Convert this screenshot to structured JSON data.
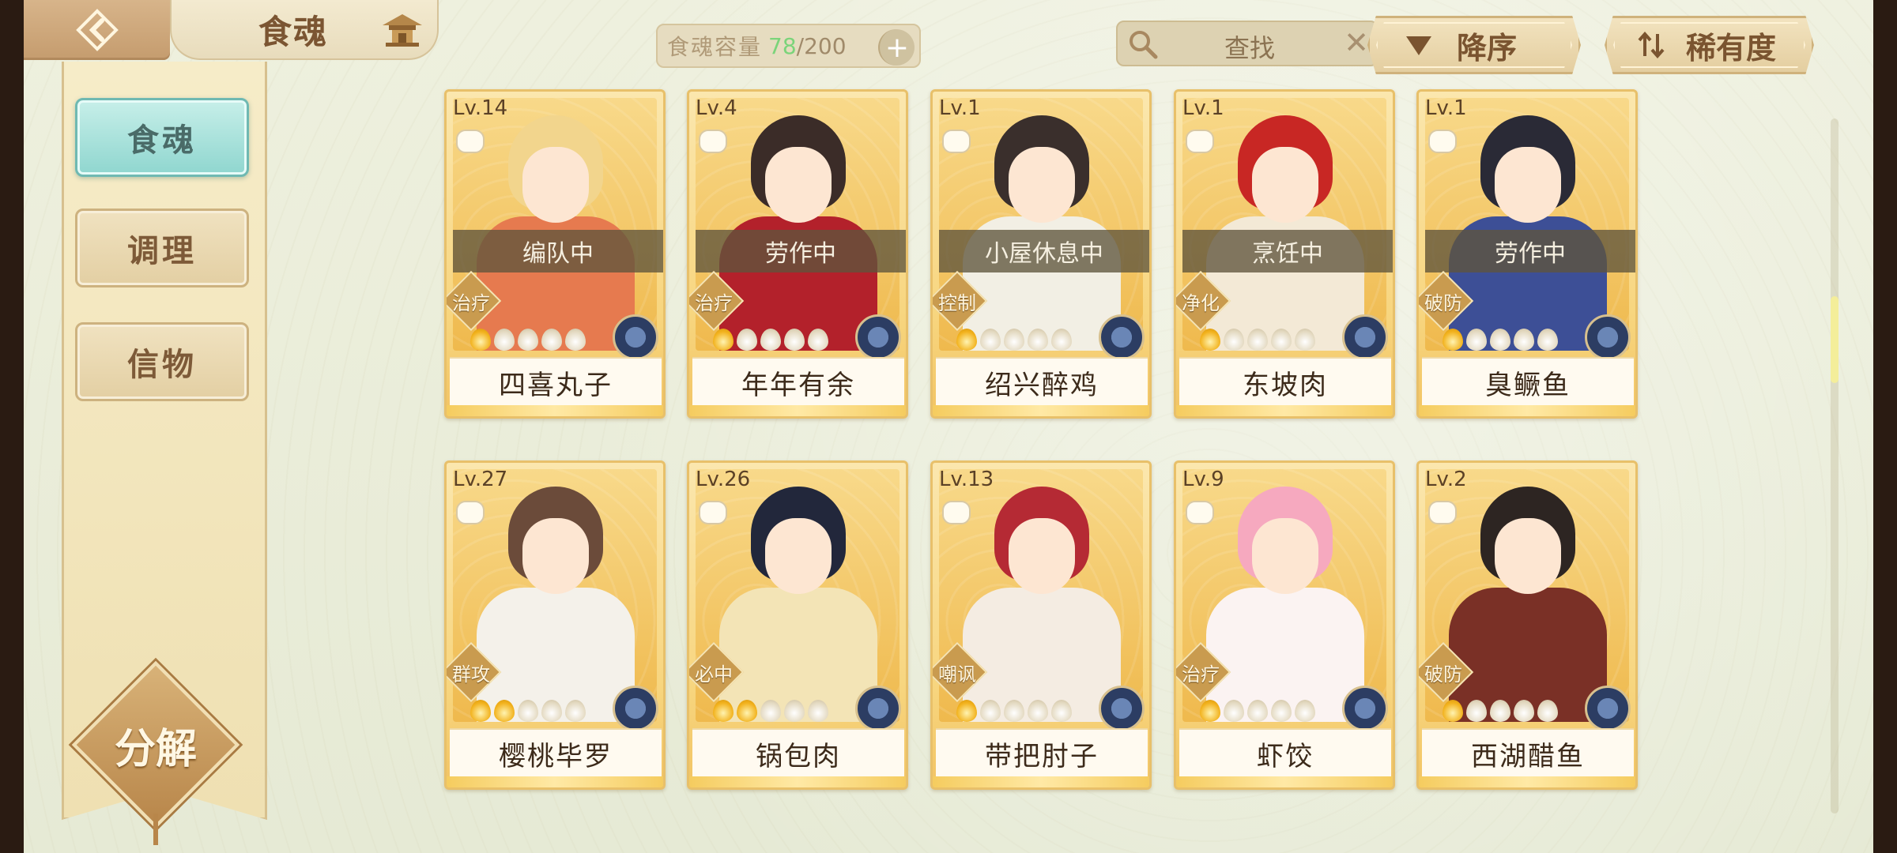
{
  "header": {
    "title": "食魂",
    "back_icon": "back-arrow-icon",
    "home_icon": "pavilion-home-icon"
  },
  "capacity": {
    "label": "食魂容量",
    "current": "78",
    "separator": "/",
    "max": "200",
    "plus": "+"
  },
  "search": {
    "placeholder": "查找",
    "clear": "✕"
  },
  "sort": {
    "order_label": "降序",
    "filter_label": "稀有度"
  },
  "sidebar": {
    "tabs": [
      {
        "label": "食魂",
        "active": true
      },
      {
        "label": "调理",
        "active": false
      },
      {
        "label": "信物",
        "active": false
      }
    ],
    "decompose_label": "分解"
  },
  "cards": [
    {
      "level": "Lv.14",
      "name": "四喜丸子",
      "status": "编队中",
      "role": "治疗",
      "stars_on": 1,
      "hair": "#f2d58d",
      "outfit": "#e67a4f"
    },
    {
      "level": "Lv.4",
      "name": "年年有余",
      "status": "劳作中",
      "role": "治疗",
      "stars_on": 1,
      "hair": "#3b2c28",
      "outfit": "#b3212b"
    },
    {
      "level": "Lv.1",
      "name": "绍兴醉鸡",
      "status": "小屋休息中",
      "role": "控制",
      "stars_on": 1,
      "hair": "#3a2f2c",
      "outfit": "#f2efe4"
    },
    {
      "level": "Lv.1",
      "name": "东坡肉",
      "status": "烹饪中",
      "role": "净化",
      "stars_on": 1,
      "hair": "#c82724",
      "outfit": "#f3e9d6"
    },
    {
      "level": "Lv.1",
      "name": "臭鳜鱼",
      "status": "劳作中",
      "role": "破防",
      "stars_on": 1,
      "hair": "#2a2a36",
      "outfit": "#3d4f96"
    },
    {
      "level": "Lv.27",
      "name": "樱桃毕罗",
      "status": "",
      "role": "群攻",
      "stars_on": 2,
      "hair": "#6b4b3a",
      "outfit": "#f4f1ea"
    },
    {
      "level": "Lv.26",
      "name": "锅包肉",
      "status": "",
      "role": "必中",
      "stars_on": 2,
      "hair": "#22273b",
      "outfit": "#f3e4b6"
    },
    {
      "level": "Lv.13",
      "name": "带把肘子",
      "status": "",
      "role": "嘲讽",
      "stars_on": 1,
      "hair": "#b52a34",
      "outfit": "#f4ece2"
    },
    {
      "level": "Lv.9",
      "name": "虾饺",
      "status": "",
      "role": "治疗",
      "stars_on": 1,
      "hair": "#f6a9bf",
      "outfit": "#fbf3f2"
    },
    {
      "level": "Lv.2",
      "name": "西湖醋鱼",
      "status": "",
      "role": "破防",
      "stars_on": 1,
      "hair": "#2d2522",
      "outfit": "#7a3026"
    }
  ]
}
